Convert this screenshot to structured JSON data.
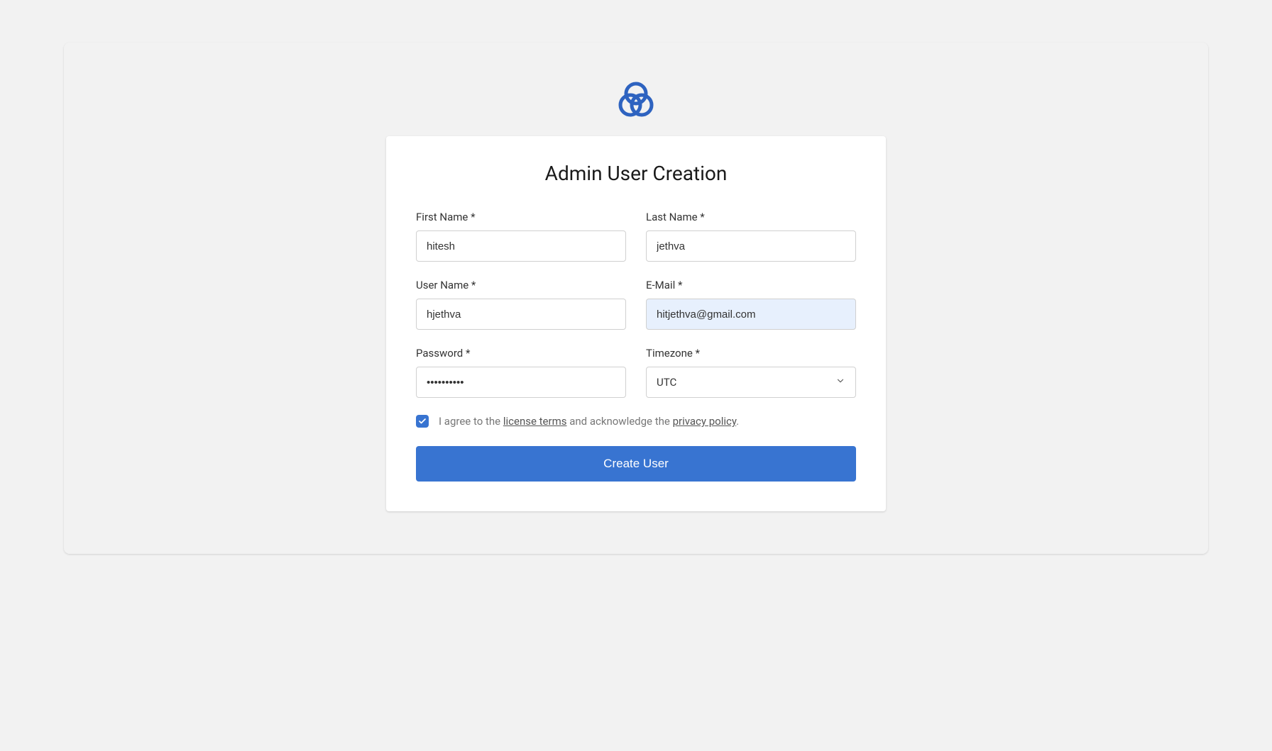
{
  "title": "Admin User Creation",
  "fields": {
    "first_name": {
      "label": "First Name *",
      "value": "hitesh"
    },
    "last_name": {
      "label": "Last Name *",
      "value": "jethva"
    },
    "user_name": {
      "label": "User Name *",
      "value": "hjethva"
    },
    "email": {
      "label": "E-Mail *",
      "value": "hitjethva@gmail.com"
    },
    "password": {
      "label": "Password *",
      "value": "••••••••••"
    },
    "timezone": {
      "label": "Timezone *",
      "value": "UTC"
    }
  },
  "consent": {
    "checked": true,
    "text_1": "I agree to the ",
    "license_link": "license terms",
    "text_2": " and acknowledge the ",
    "privacy_link": "privacy policy",
    "text_3": "."
  },
  "submit_label": "Create User"
}
